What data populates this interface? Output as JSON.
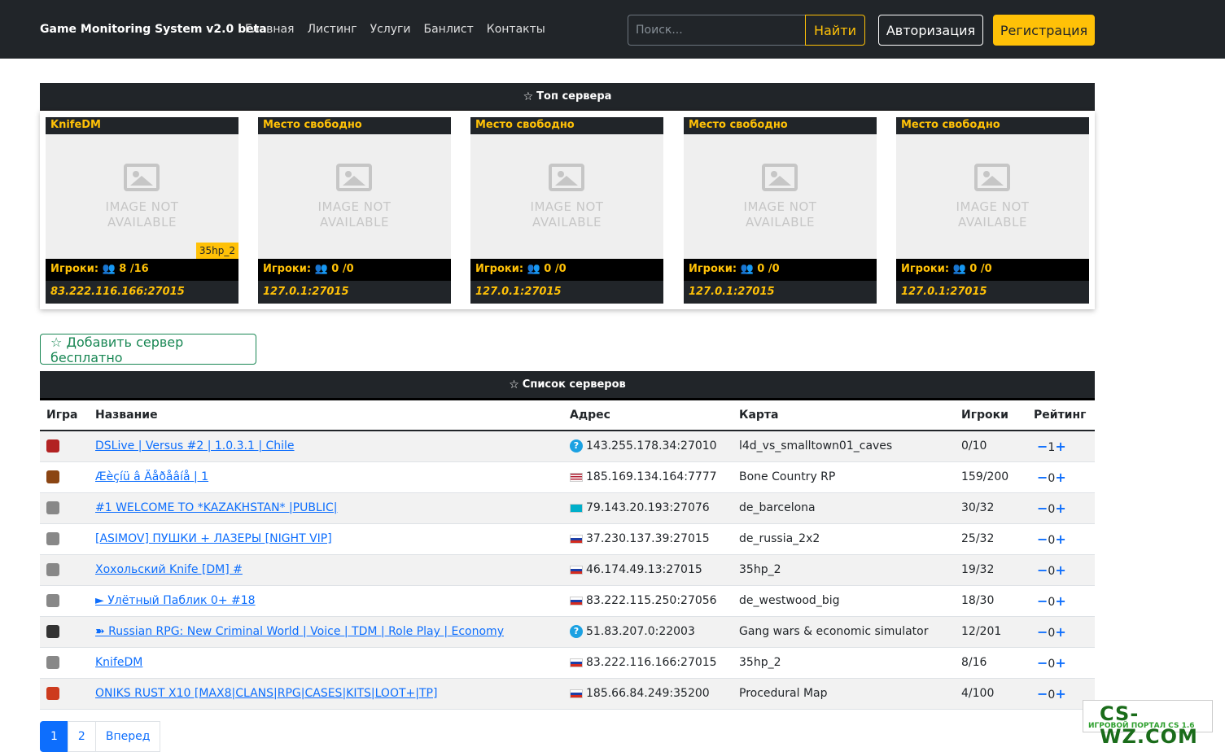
{
  "navbar": {
    "brand": "Game Monitoring System v2.0 beta",
    "links": [
      "Главная",
      "Листинг",
      "Услуги",
      "Банлист",
      "Контакты"
    ],
    "search_placeholder": "Поиск...",
    "search_button": "Найти",
    "auth_button": "Авторизация",
    "register_button": "Регистрация"
  },
  "top": {
    "title": "Топ сервера",
    "cards": [
      {
        "name": "KnifeDM",
        "img_line1": "IMAGE NOT",
        "img_line2": "AVAILABLE",
        "map": "35hp_2",
        "players": "Игроки:",
        "count": "8 /16",
        "address": "83.222.116.166:27015"
      },
      {
        "name": "Место свободно",
        "img_line1": "IMAGE NOT",
        "img_line2": "AVAILABLE",
        "map": "",
        "players": "Игроки:",
        "count": "0 /0",
        "address": "127.0.1:27015"
      },
      {
        "name": "Место свободно",
        "img_line1": "IMAGE NOT",
        "img_line2": "AVAILABLE",
        "map": "",
        "players": "Игроки:",
        "count": "0 /0",
        "address": "127.0.1:27015"
      },
      {
        "name": "Место свободно",
        "img_line1": "IMAGE NOT",
        "img_line2": "AVAILABLE",
        "map": "",
        "players": "Игроки:",
        "count": "0 /0",
        "address": "127.0.1:27015"
      },
      {
        "name": "Место свободно",
        "img_line1": "IMAGE NOT",
        "img_line2": "AVAILABLE",
        "map": "",
        "players": "Игроки:",
        "count": "0 /0",
        "address": "127.0.1:27015"
      }
    ]
  },
  "add_server_button": "Добавить сервер бесплатно",
  "list": {
    "title": "Список серверов",
    "headers": [
      "Игра",
      "Название",
      "Адрес",
      "Карта",
      "Игроки",
      "Рейтинг"
    ],
    "rows": [
      {
        "game_icon": "l4d-icon",
        "name": "DSLive | Versus #2 | 1.0.3.1 | Chile",
        "flag": "unknown",
        "address": "143.255.178.34:27010",
        "map": "l4d_vs_smalltown01_caves",
        "players": "0/10",
        "rating": "1"
      },
      {
        "game_icon": "samp-icon",
        "name": "Æèçíü â Äåðåâíå | 1",
        "flag": "us",
        "address": "185.169.134.164:7777",
        "map": "Bone Country RP",
        "players": "159/200",
        "rating": "0"
      },
      {
        "game_icon": "cs-icon",
        "name": "#1 WELCOME TO *KAZAKHSTAN* |PUBLIC|",
        "flag": "kz",
        "address": "79.143.20.193:27076",
        "map": "de_barcelona",
        "players": "30/32",
        "rating": "0"
      },
      {
        "game_icon": "cs-icon",
        "name": "[ASIMOV] ПУШКИ + ЛАЗЕРЫ [NIGHT VIP]",
        "flag": "ru",
        "address": "37.230.137.39:27015",
        "map": "de_russia_2x2",
        "players": "25/32",
        "rating": "0"
      },
      {
        "game_icon": "cs-icon",
        "name": "Хохольский Knife [DM] #",
        "flag": "ru",
        "address": "46.174.49.13:27015",
        "map": "35hp_2",
        "players": "19/32",
        "rating": "0"
      },
      {
        "game_icon": "cs-icon",
        "name": "► Улётный Паблик 0+ #18",
        "flag": "ru",
        "address": "83.222.115.250:27056",
        "map": "de_westwood_big",
        "players": "18/30",
        "rating": "0"
      },
      {
        "game_icon": "mta-icon",
        "name": "➽ Russian RPG: New Criminal World | Voice | TDM | Role Play | Economy",
        "flag": "unknown",
        "address": "51.83.207.0:22003",
        "map": "Gang wars & economic simulator",
        "players": "12/201",
        "rating": "0"
      },
      {
        "game_icon": "cs-icon",
        "name": "KnifeDM",
        "flag": "ru",
        "address": "83.222.116.166:27015",
        "map": "35hp_2",
        "players": "8/16",
        "rating": "0"
      },
      {
        "game_icon": "rust-icon",
        "name": "ONIKS RUST X10 [MAX8|CLANS|RPG|CASES|KITS|LOOT+|TP]",
        "flag": "ru",
        "address": "185.66.84.249:35200",
        "map": "Procedural Map",
        "players": "4/100",
        "rating": "0"
      }
    ]
  },
  "pagination": [
    "1",
    "2",
    "Вперед"
  ],
  "watermark": {
    "text": "CS-WZ.COM",
    "sub": "ИГРОВОЙ ПОРТАЛ CS 1.6"
  }
}
